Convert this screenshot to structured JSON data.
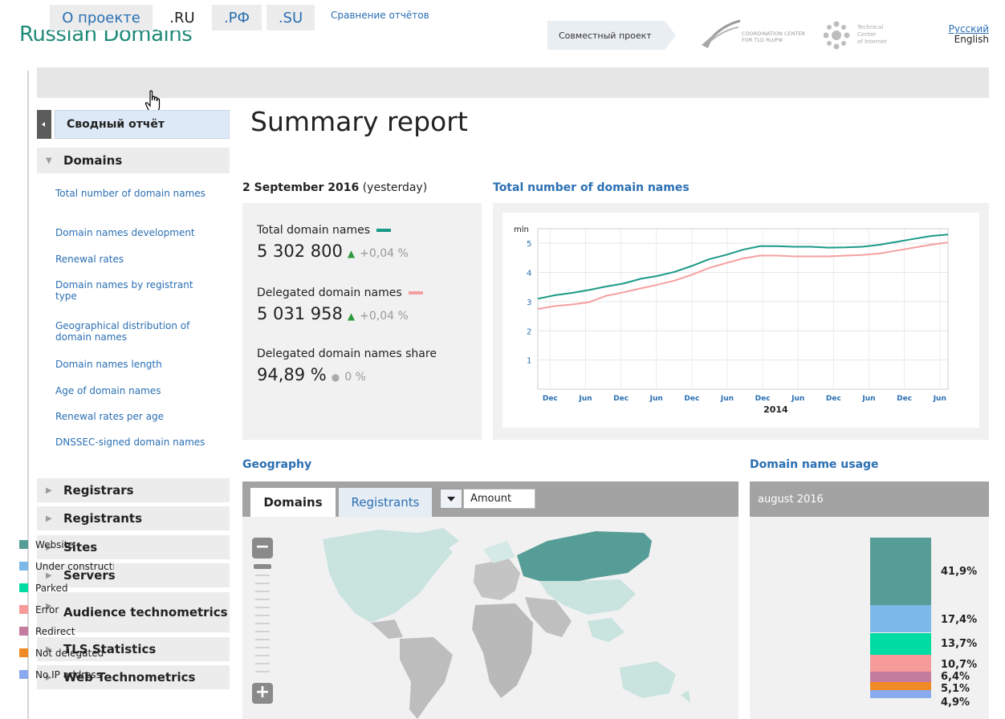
{
  "header": {
    "logo": "Russian Domains",
    "joint_project": "Совместный проект",
    "cc_logo_line1": "COORDINATION CENTER",
    "cc_logo_line2": "FOR TLD RU/РФ",
    "tci_logo_line1": "Technical",
    "tci_logo_line2": "Center",
    "tci_logo_line3": "of Internet",
    "lang_ru": "Русский",
    "lang_en": "English"
  },
  "tabs": [
    {
      "label": "О проекте"
    },
    {
      "label": ".RU"
    },
    {
      "label": ".РФ"
    },
    {
      "label": ".SU"
    },
    {
      "label": "Сравнение отчётов"
    }
  ],
  "sidebar": {
    "summary_label": "Сводный отчёт",
    "domains_label": "Domains",
    "domain_items": [
      "Total number of domain names",
      "Domain names development",
      "Renewal rates",
      "Domain names by registrant type",
      "Geographical distribution of domain names",
      "Domain names length",
      "Age of domain names",
      "Renewal rates per age",
      "DNSSEC-signed domain names"
    ],
    "sections": [
      "Registrars",
      "Registrants",
      "Sites",
      "Servers",
      "Audience technometrics",
      "TLS Statistics",
      "Web Technometrics"
    ]
  },
  "main": {
    "title": "Summary report",
    "date": "2 September 2016",
    "date_note": "(yesterday)",
    "stats": [
      {
        "label": "Total domain names",
        "value": "5 302 800",
        "delta": "+0,04 %",
        "arrow": "▲",
        "color": "#1a9a86"
      },
      {
        "label": "Delegated domain names",
        "value": "5 031 958",
        "delta": "+0,04 %",
        "arrow": "▲",
        "color": "#f5a0a0"
      },
      {
        "label": "Delegated domain names share",
        "value": "94,89 %",
        "delta": "0 %",
        "arrow": "●"
      }
    ],
    "chart_title": "Total number of domain names"
  },
  "chart_data": {
    "type": "line",
    "title": "Total number of domain names",
    "ylabel": "mln",
    "xlabel": "2014",
    "x_ticks": [
      "Dec",
      "Jun",
      "Dec",
      "Jun",
      "Dec",
      "Jun",
      "Dec",
      "Jun",
      "Dec",
      "Jun",
      "Dec",
      "Jun"
    ],
    "y_ticks": [
      "1",
      "2",
      "3",
      "4",
      "5"
    ],
    "ylim": [
      0,
      5.5
    ],
    "grid": true,
    "series": [
      {
        "name": "Total domain names",
        "color": "#1a9a86",
        "values": [
          3.1,
          3.22,
          3.3,
          3.4,
          3.52,
          3.62,
          3.78,
          3.88,
          4.02,
          4.22,
          4.45,
          4.6,
          4.78,
          4.9,
          4.9,
          4.88,
          4.88,
          4.85,
          4.86,
          4.88,
          4.95,
          5.05,
          5.15,
          5.25,
          5.3
        ]
      },
      {
        "name": "Delegated domain names",
        "color": "#f5a0a0",
        "values": [
          2.75,
          2.85,
          2.9,
          2.98,
          3.2,
          3.32,
          3.45,
          3.58,
          3.72,
          3.92,
          4.15,
          4.32,
          4.48,
          4.58,
          4.58,
          4.55,
          4.55,
          4.55,
          4.58,
          4.6,
          4.65,
          4.75,
          4.85,
          4.95,
          5.03
        ]
      }
    ]
  },
  "geography": {
    "title": "Geography",
    "tab_domains": "Domains",
    "tab_registrants": "Registrants",
    "select_value": "Amount",
    "zoom_minus": "−",
    "zoom_plus": "+"
  },
  "usage": {
    "title": "Domain name usage",
    "period": "august 2016",
    "items": [
      {
        "label": "Website",
        "color": "#569d97",
        "pct": "41,9%",
        "value": 41.9
      },
      {
        "label": "Under construction",
        "color": "#7cb9e8",
        "pct": "17,4%",
        "value": 17.4
      },
      {
        "label": "Parked",
        "color": "#00dba4",
        "pct": "13,7%",
        "value": 13.7
      },
      {
        "label": "Error",
        "color": "#f79a9a",
        "pct": "10,7%",
        "value": 10.7
      },
      {
        "label": "Redirect",
        "color": "#c47c9e",
        "pct": "6,4%",
        "value": 6.4
      },
      {
        "label": "Not delegated",
        "color": "#f08a24",
        "pct": "5,1%",
        "value": 5.1
      },
      {
        "label": "No IP address",
        "color": "#8aaaf0",
        "pct": "4,9%",
        "value": 4.9
      }
    ]
  }
}
